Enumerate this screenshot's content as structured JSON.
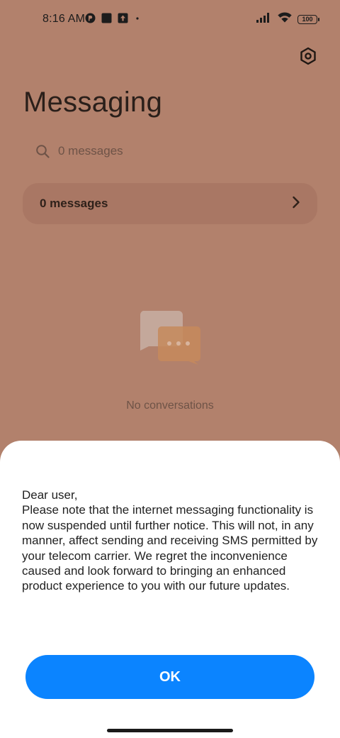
{
  "status_bar": {
    "time": "8:16 AM",
    "battery": "100",
    "icons": [
      "app-notification-icon",
      "square-notification-icon",
      "upload-notification-icon",
      "dot-icon",
      "signal-icon",
      "wifi-icon",
      "battery-icon"
    ]
  },
  "header": {
    "title": "Messaging",
    "settings_icon": "settings-icon"
  },
  "search": {
    "placeholder": "0 messages"
  },
  "summary_card": {
    "label": "0 messages"
  },
  "empty_state": {
    "text": "No conversations"
  },
  "dialog": {
    "greeting": "Dear user,",
    "message": "Please note that the internet messaging functionality is now suspended until further notice. This will not, in any manner, affect sending and receiving SMS permitted by your telecom carrier. We regret the inconvenience caused and look forward to bringing an enhanced product experience to you with our future updates.",
    "ok_label": "OK"
  },
  "colors": {
    "background_dim": "#b2816c",
    "sheet": "#ffffff",
    "primary_button": "#0b84ff"
  }
}
